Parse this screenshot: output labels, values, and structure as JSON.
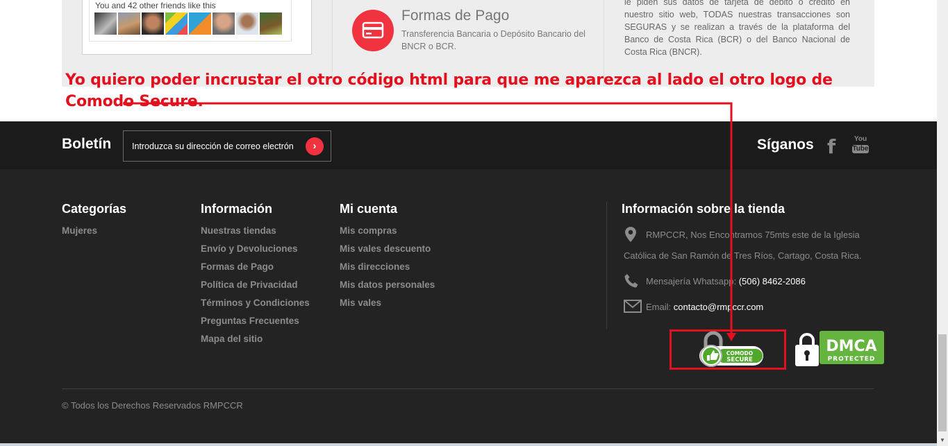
{
  "top": {
    "fb_text": "You and 42 other friends like this",
    "payment_title": "Formas de Pago",
    "payment_desc": "Transferencia Bancaria o Depósito Bancario del BNCR o BCR.",
    "security_text": "le piden sus datos de tarjeta de débito o crédito en nuestro sitio web, TODAS nuestras transacciones son SEGURAS y se realizan a través de la plataforma del Banco de Costa Rica (BCR) o del Banco Nacional de Costa Rica (BNCR)."
  },
  "annotation": {
    "text": "Yo quiero poder incrustar el otro código html para que me aparezca al lado el otro logo de Comodo Secure.",
    "color": "#e3101d"
  },
  "newsletter": {
    "title": "Boletín",
    "placeholder": "Introduzca su dirección de correo electrón",
    "follow_label": "Síganos",
    "youtube_top": "You",
    "youtube_bottom": "Tube",
    "facebook_glyph": "f",
    "go_glyph": "›"
  },
  "footer": {
    "categories": {
      "title": "Categorías",
      "items": [
        "Mujeres"
      ]
    },
    "information": {
      "title": "Información",
      "items": [
        "Nuestras tiendas",
        "Envío y Devoluciones",
        "Formas de Pago",
        "Política de Privacidad",
        "Términos y Condiciones",
        "Preguntas Frecuentes",
        "Mapa del sitio"
      ]
    },
    "account": {
      "title": "Mi cuenta",
      "items": [
        "Mis compras",
        "Mis vales descuento",
        "Mis direcciones",
        "Mis datos personales",
        "Mis vales"
      ]
    },
    "store": {
      "title": "Información sobre la tienda",
      "address_1": "RMPCCR, Nos Encontramos 75mts este de la Iglesia",
      "address_2": "Católica de San Ramón de Tres Ríos, Cartago, Costa Rica.",
      "phone_label": "Mensajería Whatsapp:",
      "phone": "(506) 8462-2086",
      "email_label": "Email:",
      "email": "contacto@rmpccr.com"
    },
    "badges": {
      "comodo_line1": "COMODO",
      "comodo_line2": "SECURE",
      "dmca_text": "DMCA",
      "dmca_sub": "PROTECTED"
    },
    "copyright": "© Todos los Derechos Reservados RMPCCR"
  },
  "colors": {
    "accent": "#f13340",
    "footer_bg": "#232323",
    "bar_bg": "#1b1b1b"
  }
}
